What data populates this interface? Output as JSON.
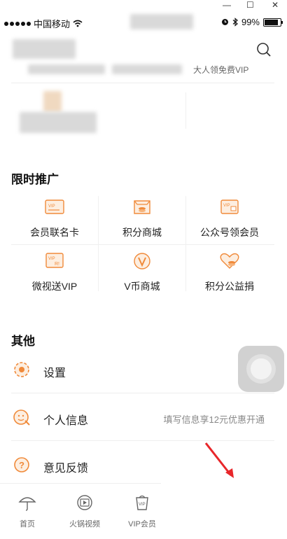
{
  "window": {
    "minimize": "—",
    "maximize": "☐",
    "close": "✕"
  },
  "status": {
    "carrier": "中国移动",
    "battery": "99%"
  },
  "header": {
    "blurred_text": "大人领免费VIP"
  },
  "promo": {
    "title": "限时推广",
    "items": [
      {
        "label": "会员联名卡",
        "icon": "vip-card-icon"
      },
      {
        "label": "积分商城",
        "icon": "points-mall-icon"
      },
      {
        "label": "公众号领会员",
        "icon": "official-account-vip-icon"
      },
      {
        "label": "微视送VIP",
        "icon": "weishi-vip-icon"
      },
      {
        "label": "V币商城",
        "icon": "vcoin-mall-icon"
      },
      {
        "label": "积分公益捐",
        "icon": "points-charity-icon"
      }
    ]
  },
  "other": {
    "title": "其他",
    "rows": [
      {
        "label": "设置",
        "hint": "",
        "icon": "settings-gear-icon"
      },
      {
        "label": "个人信息",
        "hint": "填写信息享12元优惠开通",
        "icon": "personal-info-icon"
      },
      {
        "label": "意见反馈",
        "hint": "",
        "icon": "feedback-icon"
      }
    ]
  },
  "tabs": [
    {
      "label": "首页",
      "icon": "umbrella-home-icon"
    },
    {
      "label": "火锅视频",
      "icon": "video-play-icon"
    },
    {
      "label": "VIP会员",
      "icon": "vip-cup-icon"
    }
  ],
  "colors": {
    "accent": "#f08a3a",
    "arrow": "#e8262a"
  }
}
